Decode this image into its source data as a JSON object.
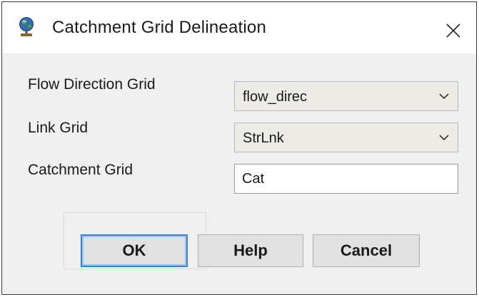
{
  "dialog": {
    "title": "Catchment Grid Delineation",
    "title_icon": "globe-app-icon",
    "close_icon": "close-icon"
  },
  "fields": {
    "flow_direction": {
      "label": "Flow Direction Grid",
      "value": "flow_direc"
    },
    "link_grid": {
      "label": "Link Grid",
      "value": "StrLnk"
    },
    "catchment_grid": {
      "label": "Catchment Grid",
      "value": "Cat"
    }
  },
  "buttons": {
    "ok": "OK",
    "help": "Help",
    "cancel": "Cancel"
  },
  "colors": {
    "dialog_bg": "#f0f0f0",
    "focus_border": "#3c7fd6"
  }
}
